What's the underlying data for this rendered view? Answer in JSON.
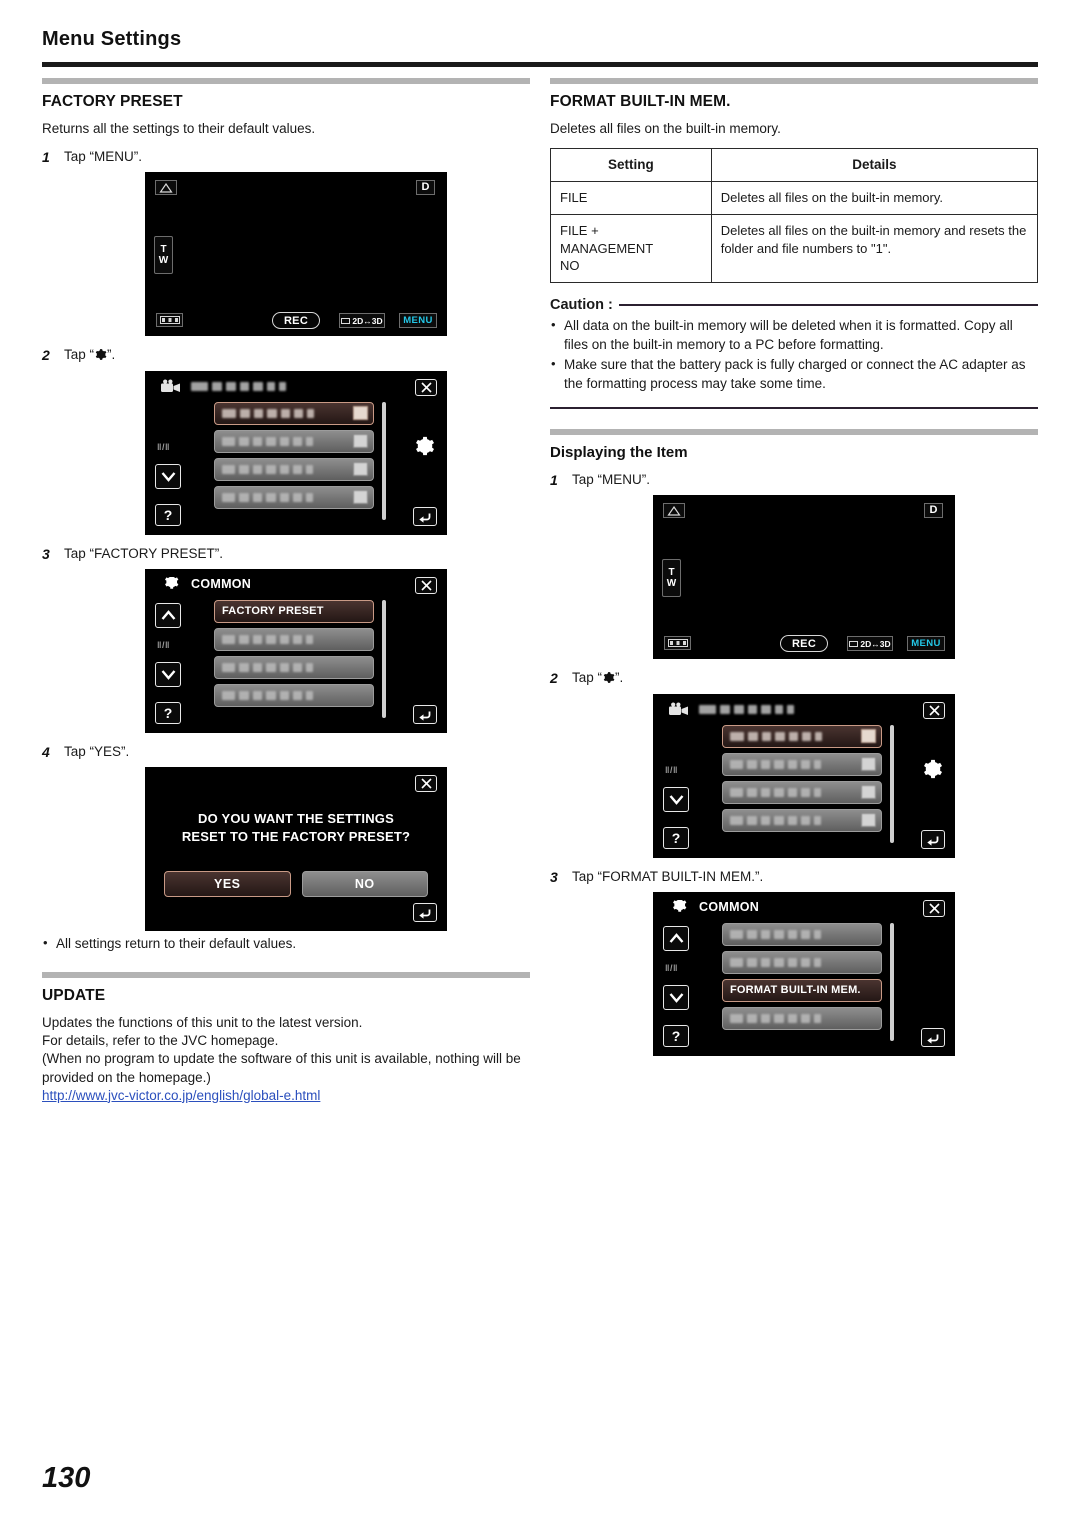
{
  "header": {
    "title": "Menu Settings"
  },
  "page_number": "130",
  "left": {
    "section1": {
      "heading": "FACTORY PRESET",
      "intro": "Returns all the settings to their default values.",
      "steps": [
        {
          "num": "1",
          "text": "Tap “MENU”."
        },
        {
          "num": "2",
          "text_before": "Tap “",
          "icon": "gear-icon",
          "text_after": "”."
        },
        {
          "num": "3",
          "text": "Tap “FACTORY PRESET”."
        },
        {
          "num": "4",
          "text": "Tap “YES”."
        }
      ],
      "note": "All settings return to their default values."
    },
    "section2": {
      "heading": "UPDATE",
      "lines": [
        "Updates the functions of this unit to the latest version.",
        "For details, refer to the JVC homepage.",
        "(When no program to update the software of this unit is available, nothing will be provided on the homepage.)"
      ],
      "link": "http://www.jvc-victor.co.jp/english/global-e.html"
    }
  },
  "right": {
    "section1": {
      "heading": "FORMAT BUILT-IN MEM.",
      "intro": "Deletes all files on the built-in memory.",
      "table": {
        "columns": [
          "Setting",
          "Details"
        ],
        "rows": [
          [
            "FILE",
            "Deletes all files on the built-in memory."
          ],
          [
            "FILE +\nMANAGEMENT\nNO",
            "Deletes all files on the built-in memory and resets the folder and file numbers to \"1\"."
          ]
        ]
      },
      "caution": {
        "label": "Caution :",
        "items": [
          "All data on the built-in memory will be deleted when it is formatted. Copy all files on the built-in memory to a PC before formatting.",
          "Make sure that the battery pack is fully charged or connect the AC adapter as the formatting process may take some time."
        ]
      }
    },
    "section2": {
      "heading": "Displaying the Item",
      "steps": [
        {
          "num": "1",
          "text": "Tap “MENU”."
        },
        {
          "num": "2",
          "text_before": "Tap “",
          "icon": "gear-icon",
          "text_after": "”."
        },
        {
          "num": "3",
          "text": "Tap “FORMAT BUILT-IN MEM.”."
        }
      ]
    }
  },
  "screens": {
    "rec": {
      "mountain_icon": "scene-mountain-icon",
      "d_label": "D",
      "zoom_t": "T",
      "zoom_w": "W",
      "playback_icon": "film-playback-icon",
      "rec_label": "REC",
      "mode_2d3d_label": "2D↔3D",
      "menu_label": "MENU"
    },
    "menu_video": {
      "header_icon": "camcorder-icon",
      "header_label": "",
      "close_icon": "close-icon",
      "gear_icon": "gear-icon",
      "back_icon": "back-arrow-icon",
      "up_icon": "chevron-up-icon",
      "down_icon": "chevron-down-icon",
      "pause_play_label": "‖/‖",
      "help_label": "?",
      "items": [
        "",
        "",
        "",
        ""
      ],
      "selected_index": 0
    },
    "menu_common_factory": {
      "header_icon": "gear-icon",
      "header_label": "COMMON",
      "items": [
        "FACTORY PRESET",
        "",
        "",
        ""
      ],
      "selected_index": 0
    },
    "menu_common_format": {
      "header_icon": "gear-icon",
      "header_label": "COMMON",
      "items": [
        "",
        "",
        "FORMAT BUILT-IN MEM.",
        ""
      ],
      "selected_index": 2
    },
    "dialog_factory": {
      "message_line1": "DO YOU WANT THE SETTINGS",
      "message_line2": "RESET TO THE FACTORY PRESET?",
      "yes_label": "YES",
      "no_label": "NO",
      "close_icon": "close-icon",
      "back_icon": "back-arrow-icon"
    }
  },
  "colors": {
    "menu_accent": "#23c8e8",
    "link": "#2b4fbd",
    "section_bar": "#b3b3b3",
    "rule": "#1a1a1a"
  }
}
